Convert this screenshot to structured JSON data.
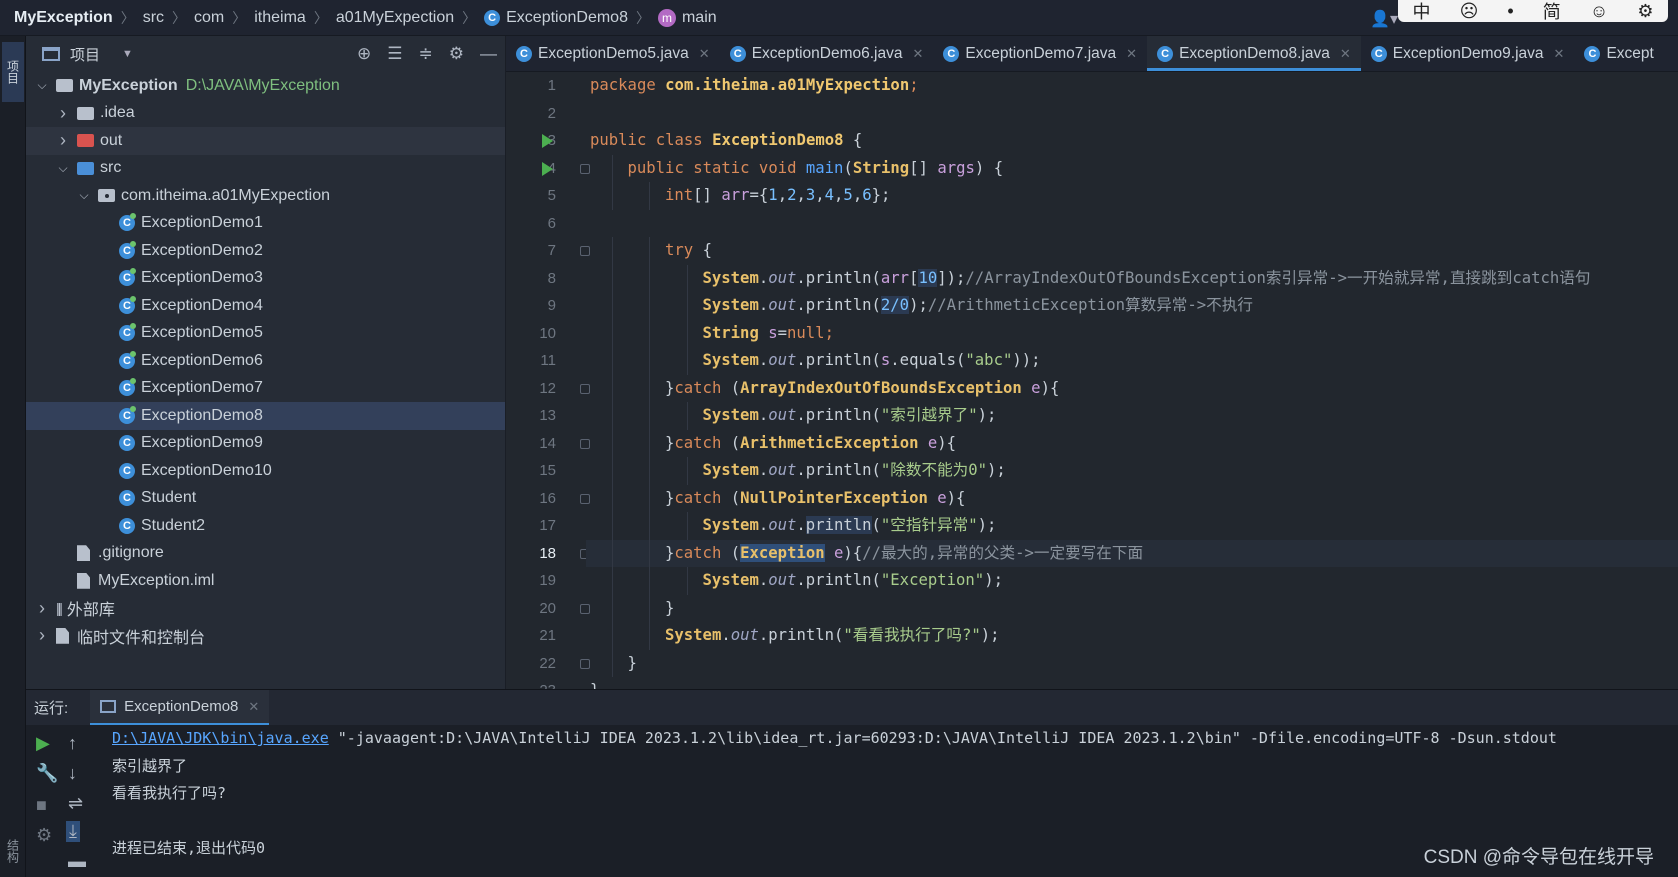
{
  "breadcrumb": {
    "project": "MyException",
    "items": [
      "src",
      "com",
      "itheima",
      "a01MyExpection",
      "ExceptionDemo8",
      "main"
    ]
  },
  "ime": [
    "中",
    "☹",
    "•",
    "简",
    "☺",
    "⚙"
  ],
  "left_strip": {
    "project_tab": "项目",
    "structure_tab": "结构"
  },
  "project_panel": {
    "title": "项目",
    "tree": [
      {
        "label": "MyException",
        "hint": "D:\\JAVA\\MyException",
        "depth": 0,
        "chev": "open",
        "icon": "folder-gray"
      },
      {
        "label": ".idea",
        "depth": 1,
        "chev": "closed",
        "icon": "folder-gray"
      },
      {
        "label": "out",
        "depth": 1,
        "chev": "closed",
        "icon": "folder-red"
      },
      {
        "label": "src",
        "depth": 1,
        "chev": "open",
        "icon": "folder-blue"
      },
      {
        "label": "com.itheima.a01MyExpection",
        "depth": 2,
        "chev": "open",
        "icon": "package"
      },
      {
        "label": "ExceptionDemo1",
        "depth": 3,
        "icon": "class-run"
      },
      {
        "label": "ExceptionDemo2",
        "depth": 3,
        "icon": "class-run"
      },
      {
        "label": "ExceptionDemo3",
        "depth": 3,
        "icon": "class-run"
      },
      {
        "label": "ExceptionDemo4",
        "depth": 3,
        "icon": "class-run"
      },
      {
        "label": "ExceptionDemo5",
        "depth": 3,
        "icon": "class-run"
      },
      {
        "label": "ExceptionDemo6",
        "depth": 3,
        "icon": "class-run"
      },
      {
        "label": "ExceptionDemo7",
        "depth": 3,
        "icon": "class-run"
      },
      {
        "label": "ExceptionDemo8",
        "depth": 3,
        "icon": "class-run",
        "selected": true
      },
      {
        "label": "ExceptionDemo9",
        "depth": 3,
        "icon": "class"
      },
      {
        "label": "ExceptionDemo10",
        "depth": 3,
        "icon": "class"
      },
      {
        "label": "Student",
        "depth": 3,
        "icon": "class"
      },
      {
        "label": "Student2",
        "depth": 3,
        "icon": "class"
      },
      {
        "label": ".gitignore",
        "depth": 1,
        "icon": "file"
      },
      {
        "label": "MyException.iml",
        "depth": 1,
        "icon": "file"
      },
      {
        "label": "外部库",
        "depth": 0,
        "chev": "closed",
        "icon": "library"
      },
      {
        "label": "临时文件和控制台",
        "depth": 0,
        "chev": "closed",
        "icon": "scratch"
      }
    ]
  },
  "tabs": [
    {
      "label": "ExceptionDemo5.java"
    },
    {
      "label": "ExceptionDemo6.java"
    },
    {
      "label": "ExceptionDemo7.java"
    },
    {
      "label": "ExceptionDemo8.java",
      "active": true
    },
    {
      "label": "ExceptionDemo9.java"
    },
    {
      "label": "Except"
    }
  ],
  "editor": {
    "current_line": 18,
    "run_arrow_lines": [
      3,
      4
    ],
    "fold_lines": [
      4,
      7,
      12,
      14,
      16,
      18,
      20,
      22
    ],
    "bulb_line": 18,
    "lines": [
      {
        "n": 1,
        "indent": 0,
        "parts": [
          [
            "kw",
            "package "
          ],
          [
            "cls",
            "com.itheima.a01MyExpection"
          ],
          [
            "kw",
            ";"
          ]
        ]
      },
      {
        "n": 2,
        "indent": 0,
        "parts": []
      },
      {
        "n": 3,
        "indent": 0,
        "parts": [
          [
            "kw",
            "public class "
          ],
          [
            "cls",
            "ExceptionDemo8 "
          ],
          [
            "",
            "{"
          ]
        ]
      },
      {
        "n": 4,
        "indent": 1,
        "parts": [
          [
            "kw",
            "public static void "
          ],
          [
            "fn",
            "main"
          ],
          [
            "",
            "("
          ],
          [
            "ty",
            "String"
          ],
          [
            "",
            "[] "
          ],
          [
            "pa",
            "args"
          ],
          [
            "",
            ") {"
          ]
        ]
      },
      {
        "n": 5,
        "indent": 2,
        "parts": [
          [
            "kw",
            "int"
          ],
          [
            "",
            "[] "
          ],
          [
            "pa",
            "arr"
          ],
          [
            "",
            "={"
          ],
          [
            "nm",
            "1"
          ],
          [
            "",
            ","
          ],
          [
            "nm",
            "2"
          ],
          [
            "",
            ","
          ],
          [
            "nm",
            "3"
          ],
          [
            "",
            ","
          ],
          [
            "nm",
            "4"
          ],
          [
            "",
            ","
          ],
          [
            "nm",
            "5"
          ],
          [
            "",
            ","
          ],
          [
            "nm",
            "6"
          ],
          [
            "",
            "};"
          ]
        ]
      },
      {
        "n": 6,
        "indent": 0,
        "parts": []
      },
      {
        "n": 7,
        "indent": 2,
        "parts": [
          [
            "kw",
            "try "
          ],
          [
            "",
            "{"
          ]
        ]
      },
      {
        "n": 8,
        "indent": 3,
        "parts": [
          [
            "ty",
            "System"
          ],
          [
            "",
            "."
          ],
          [
            "it",
            "out"
          ],
          [
            "",
            ".println("
          ],
          [
            "pa",
            "arr"
          ],
          [
            "",
            "["
          ],
          [
            "nm hl2",
            "10"
          ],
          [
            "",
            "]);"
          ],
          [
            "cm",
            "//ArrayIndexOutOfBoundsException索引异常->一开始就异常,直接跳到catch语句"
          ]
        ]
      },
      {
        "n": 9,
        "indent": 3,
        "parts": [
          [
            "ty",
            "System"
          ],
          [
            "",
            "."
          ],
          [
            "it",
            "out"
          ],
          [
            "",
            ".println("
          ],
          [
            "nm hl2",
            "2/0"
          ],
          [
            "",
            ");"
          ],
          [
            "cm",
            "//ArithmeticException算数异常->不执行"
          ]
        ]
      },
      {
        "n": 10,
        "indent": 3,
        "parts": [
          [
            "ty",
            "String "
          ],
          [
            "pa",
            "s"
          ],
          [
            "",
            "="
          ],
          [
            "kw",
            "null"
          ],
          [
            "kw",
            ";"
          ]
        ]
      },
      {
        "n": 11,
        "indent": 3,
        "parts": [
          [
            "ty",
            "System"
          ],
          [
            "",
            "."
          ],
          [
            "it",
            "out"
          ],
          [
            "",
            ".println("
          ],
          [
            "pa",
            "s"
          ],
          [
            "",
            ".equals("
          ],
          [
            "st",
            "\"abc\""
          ],
          [
            "",
            "));"
          ]
        ]
      },
      {
        "n": 12,
        "indent": 2,
        "parts": [
          [
            "",
            "}"
          ],
          [
            "kw",
            "catch "
          ],
          [
            "",
            "("
          ],
          [
            "ty",
            "ArrayIndexOutOfBoundsException "
          ],
          [
            "pa",
            "e"
          ],
          [
            "",
            "){"
          ]
        ]
      },
      {
        "n": 13,
        "indent": 3,
        "parts": [
          [
            "ty",
            "System"
          ],
          [
            "",
            "."
          ],
          [
            "it",
            "out"
          ],
          [
            "",
            ".println("
          ],
          [
            "st",
            "\"索引越界了\""
          ],
          [
            "",
            ");"
          ]
        ]
      },
      {
        "n": 14,
        "indent": 2,
        "parts": [
          [
            "",
            "}"
          ],
          [
            "kw",
            "catch "
          ],
          [
            "",
            "("
          ],
          [
            "ty",
            "ArithmeticException "
          ],
          [
            "pa",
            "e"
          ],
          [
            "",
            "){"
          ]
        ]
      },
      {
        "n": 15,
        "indent": 3,
        "parts": [
          [
            "ty",
            "System"
          ],
          [
            "",
            "."
          ],
          [
            "it",
            "out"
          ],
          [
            "",
            ".println("
          ],
          [
            "st",
            "\"除数不能为0\""
          ],
          [
            "",
            ");"
          ]
        ]
      },
      {
        "n": 16,
        "indent": 2,
        "parts": [
          [
            "",
            "}"
          ],
          [
            "kw",
            "catch "
          ],
          [
            "",
            "("
          ],
          [
            "ty",
            "NullPointerException "
          ],
          [
            "pa",
            "e"
          ],
          [
            "",
            "){"
          ]
        ]
      },
      {
        "n": 17,
        "indent": 3,
        "parts": [
          [
            "ty",
            "System"
          ],
          [
            "",
            "."
          ],
          [
            "it",
            "out"
          ],
          [
            "",
            "."
          ],
          [
            "hl2",
            "println"
          ],
          [
            "",
            "("
          ],
          [
            "st",
            "\"空指针异常\""
          ],
          [
            "",
            ");"
          ]
        ]
      },
      {
        "n": 18,
        "indent": 2,
        "parts": [
          [
            "",
            "}"
          ],
          [
            "kw",
            "catch "
          ],
          [
            "",
            "("
          ],
          [
            "ty hl",
            "Exception"
          ],
          [
            "",
            ""
          ],
          [
            "pa",
            " e"
          ],
          [
            "",
            "){"
          ],
          [
            "cm",
            "//最大的,异常的父类->一定要写在下面"
          ]
        ]
      },
      {
        "n": 19,
        "indent": 3,
        "parts": [
          [
            "ty",
            "System"
          ],
          [
            "",
            "."
          ],
          [
            "it",
            "out"
          ],
          [
            "",
            ".println("
          ],
          [
            "st",
            "\"Exception\""
          ],
          [
            "",
            ");"
          ]
        ]
      },
      {
        "n": 20,
        "indent": 2,
        "parts": [
          [
            "",
            "}"
          ]
        ]
      },
      {
        "n": 21,
        "indent": 2,
        "parts": [
          [
            "ty",
            "System"
          ],
          [
            "",
            "."
          ],
          [
            "it",
            "out"
          ],
          [
            "",
            ".println("
          ],
          [
            "st",
            "\"看看我执行了吗?\""
          ],
          [
            "",
            ");"
          ]
        ]
      },
      {
        "n": 22,
        "indent": 1,
        "parts": [
          [
            "",
            "}"
          ]
        ]
      },
      {
        "n": 23,
        "indent": 0,
        "parts": [
          [
            "",
            "}"
          ]
        ]
      }
    ]
  },
  "run_panel": {
    "label": "运行:",
    "tab": "ExceptionDemo8",
    "console": {
      "java_path": "D:\\JAVA\\JDK\\bin\\java.exe",
      "cmd_rest": " \"-javaagent:D:\\JAVA\\IntelliJ IDEA 2023.1.2\\lib\\idea_rt.jar=60293:D:\\JAVA\\IntelliJ IDEA 2023.1.2\\bin\" -Dfile.encoding=UTF-8 -Dsun.stdout",
      "out1": "索引越界了",
      "out2": "看看我执行了吗?",
      "out3": "",
      "exit": "进程已结束,退出代码0"
    }
  },
  "watermark": "CSDN @命令导包在线开导"
}
